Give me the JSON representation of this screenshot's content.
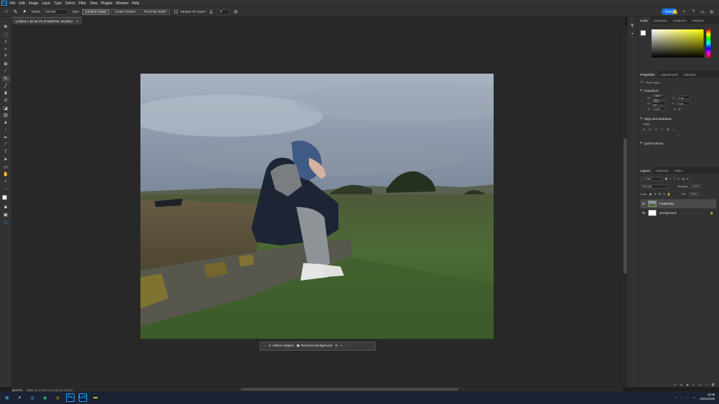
{
  "menubar": {
    "app_icon": "Ps",
    "items": [
      "File",
      "Edit",
      "Image",
      "Layer",
      "Type",
      "Select",
      "Filter",
      "View",
      "Plugins",
      "Window",
      "Help"
    ]
  },
  "options": {
    "mode_label": "Mode:",
    "mode_value": "Normal",
    "type_label": "Type:",
    "type_buttons": [
      "Content-Aware",
      "Create Texture",
      "Proximity Match"
    ],
    "sample_all_label": "Sample All Layers",
    "angle_value": "0°",
    "share_label": "Share"
  },
  "document": {
    "tab_title": "Untitled-1 @ 66.7% (P1060794, RGB/8) *",
    "zoom": "66.67%",
    "doc_info": "1890 px x 1417 px (118.11 ppcm)"
  },
  "context_bar": {
    "select_subject": "Select subject",
    "remove_background": "Remove background"
  },
  "color_panel": {
    "tabs": [
      "Color",
      "Swatches",
      "Gradients",
      "Patterns"
    ],
    "hue_color": "#ffff00"
  },
  "properties_panel": {
    "tabs": [
      "Properties",
      "Adjustments",
      "Libraries"
    ],
    "layer_type": "Pixel Layer",
    "transform_title": "Transform",
    "w_label": "W",
    "w_value": "1890 px",
    "h_label": "H",
    "h_value": "1417 px",
    "x_label": "X",
    "x_value": "0 px",
    "y_label": "Y",
    "y_value": "0 px",
    "angle_value": "0.00°",
    "align_title": "Align and Distribute",
    "align_label": "Align:",
    "quick_actions_title": "Quick Actions"
  },
  "layers_panel": {
    "tabs": [
      "Layers",
      "Channels",
      "Paths"
    ],
    "kind_label": "Kind",
    "blend_mode": "Normal",
    "opacity_label": "Opacity:",
    "opacity_value": "100%",
    "lock_label": "Lock:",
    "fill_label": "Fill:",
    "fill_value": "100%",
    "layers": [
      {
        "name": "P1060794"
      },
      {
        "name": "Background"
      }
    ]
  },
  "taskbar": {
    "time": "10:36",
    "date": "10/01/2025",
    "apps": [
      "Ps",
      "LrC"
    ]
  }
}
